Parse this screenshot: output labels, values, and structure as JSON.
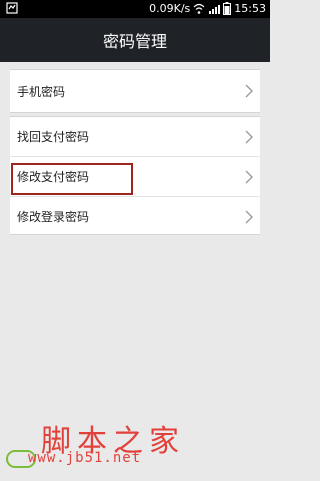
{
  "status_bar": {
    "network_speed": "0.09K/s",
    "time": "15:53"
  },
  "header": {
    "title": "密码管理"
  },
  "groups": [
    {
      "items": [
        {
          "label": "手机密码"
        }
      ]
    },
    {
      "items": [
        {
          "label": "找回支付密码"
        },
        {
          "label": "修改支付密码"
        },
        {
          "label": "修改登录密码"
        }
      ]
    }
  ],
  "watermark": {
    "title": "脚本之家",
    "url": "www.jb51.net"
  },
  "colors": {
    "header_bg": "#1f2328",
    "page_bg": "#e9e9e9",
    "highlight": "#a0251f",
    "watermark": "#e2413b"
  },
  "icons": [
    "notification-icon",
    "wifi-icon",
    "signal-icon",
    "battery-icon",
    "chevron-right-icon"
  ]
}
